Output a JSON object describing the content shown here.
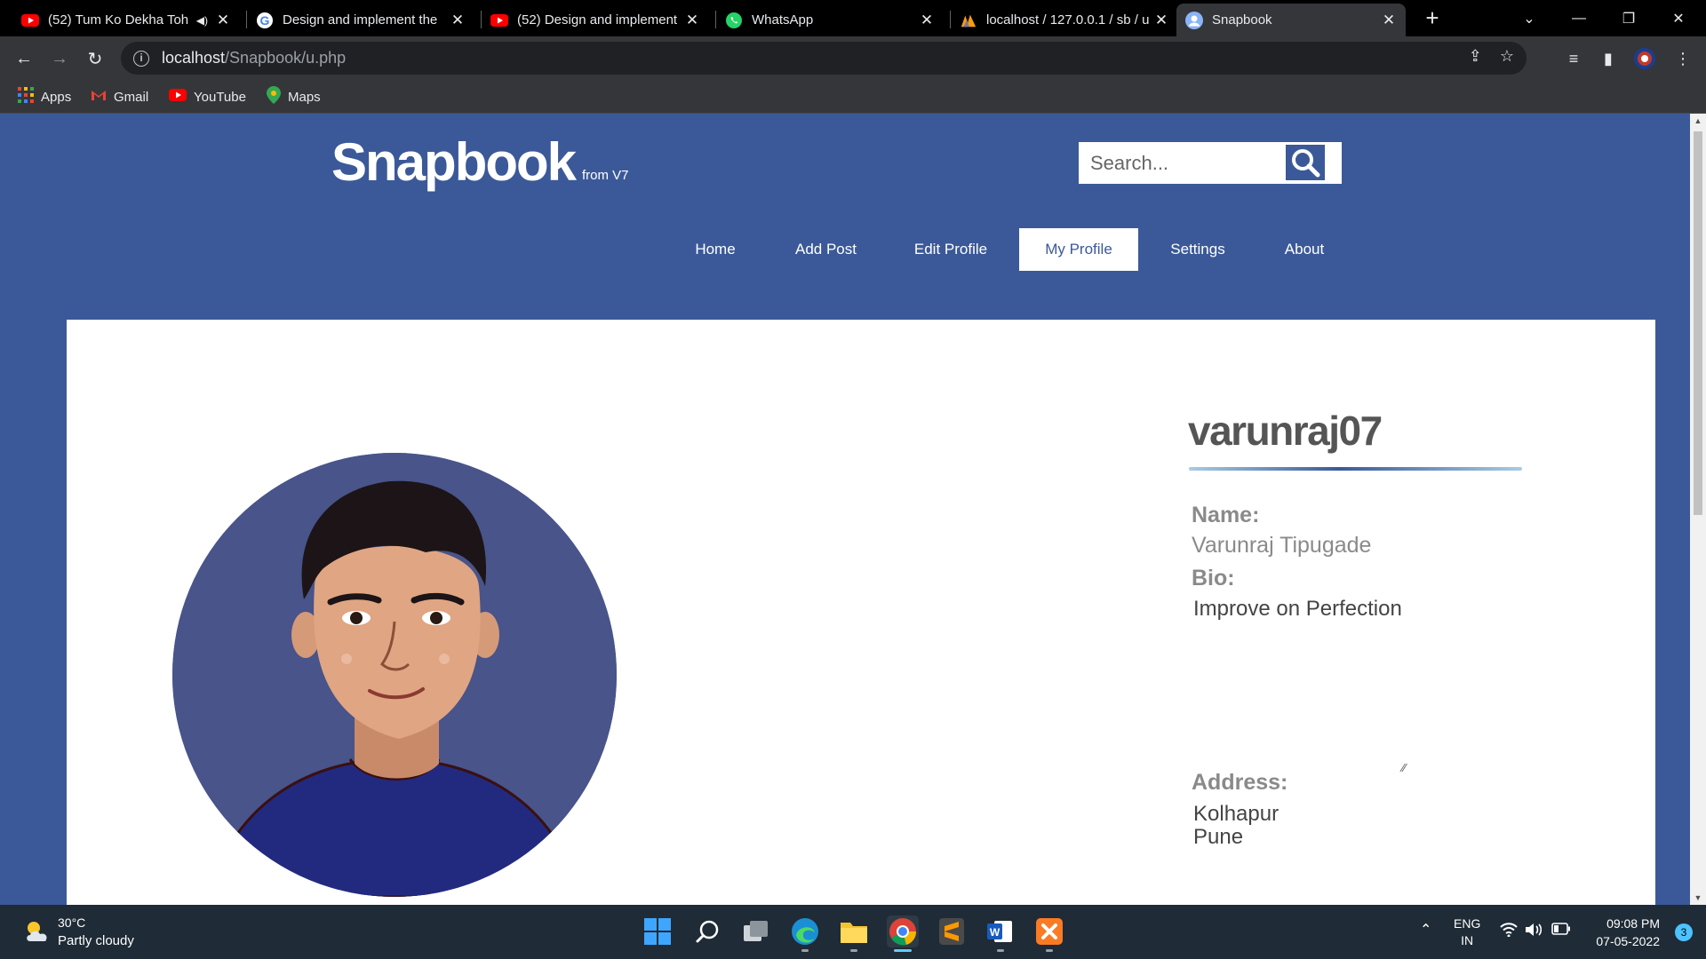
{
  "browser": {
    "tabs": [
      {
        "title": "(52) Tum Ko Dekha Toh",
        "icon": "youtube-icon",
        "audio": true
      },
      {
        "title": "Design and implement the",
        "icon": "google-icon"
      },
      {
        "title": "(52) Design and implement",
        "icon": "youtube-icon"
      },
      {
        "title": "WhatsApp",
        "icon": "whatsapp-icon"
      },
      {
        "title": "localhost / 127.0.0.1 / sb / u",
        "icon": "phpmyadmin-icon"
      },
      {
        "title": "Snapbook",
        "icon": "profile-icon",
        "active": true
      }
    ],
    "url_host": "localhost",
    "url_path": "/Snapbook/u.php",
    "bookmarks": [
      "Apps",
      "Gmail",
      "YouTube",
      "Maps"
    ]
  },
  "site": {
    "logo": "Snapbook",
    "logo_sub": "from V7",
    "search_placeholder": "Search...",
    "nav": [
      "Home",
      "Add Post",
      "Edit Profile",
      "My Profile",
      "Settings",
      "About"
    ],
    "active_nav": "My Profile"
  },
  "profile": {
    "username": "varunraj07",
    "name_label": "Name:",
    "name": "Varunraj Tipugade",
    "bio_label": "Bio:",
    "bio": "Improve on Perfection",
    "address_label": "Address:",
    "address_line1": "Kolhapur",
    "address_line2": "Pune"
  },
  "taskbar": {
    "temperature": "30°C",
    "weather": "Partly cloudy",
    "lang": "ENG",
    "region": "IN",
    "time": "09:08 PM",
    "date": "07-05-2022",
    "notifications": "3"
  },
  "colors": {
    "brand": "#3b5998",
    "page_bg": "#3b5998",
    "card_bg": "#ffffff",
    "text_muted": "#8a8a8a"
  }
}
